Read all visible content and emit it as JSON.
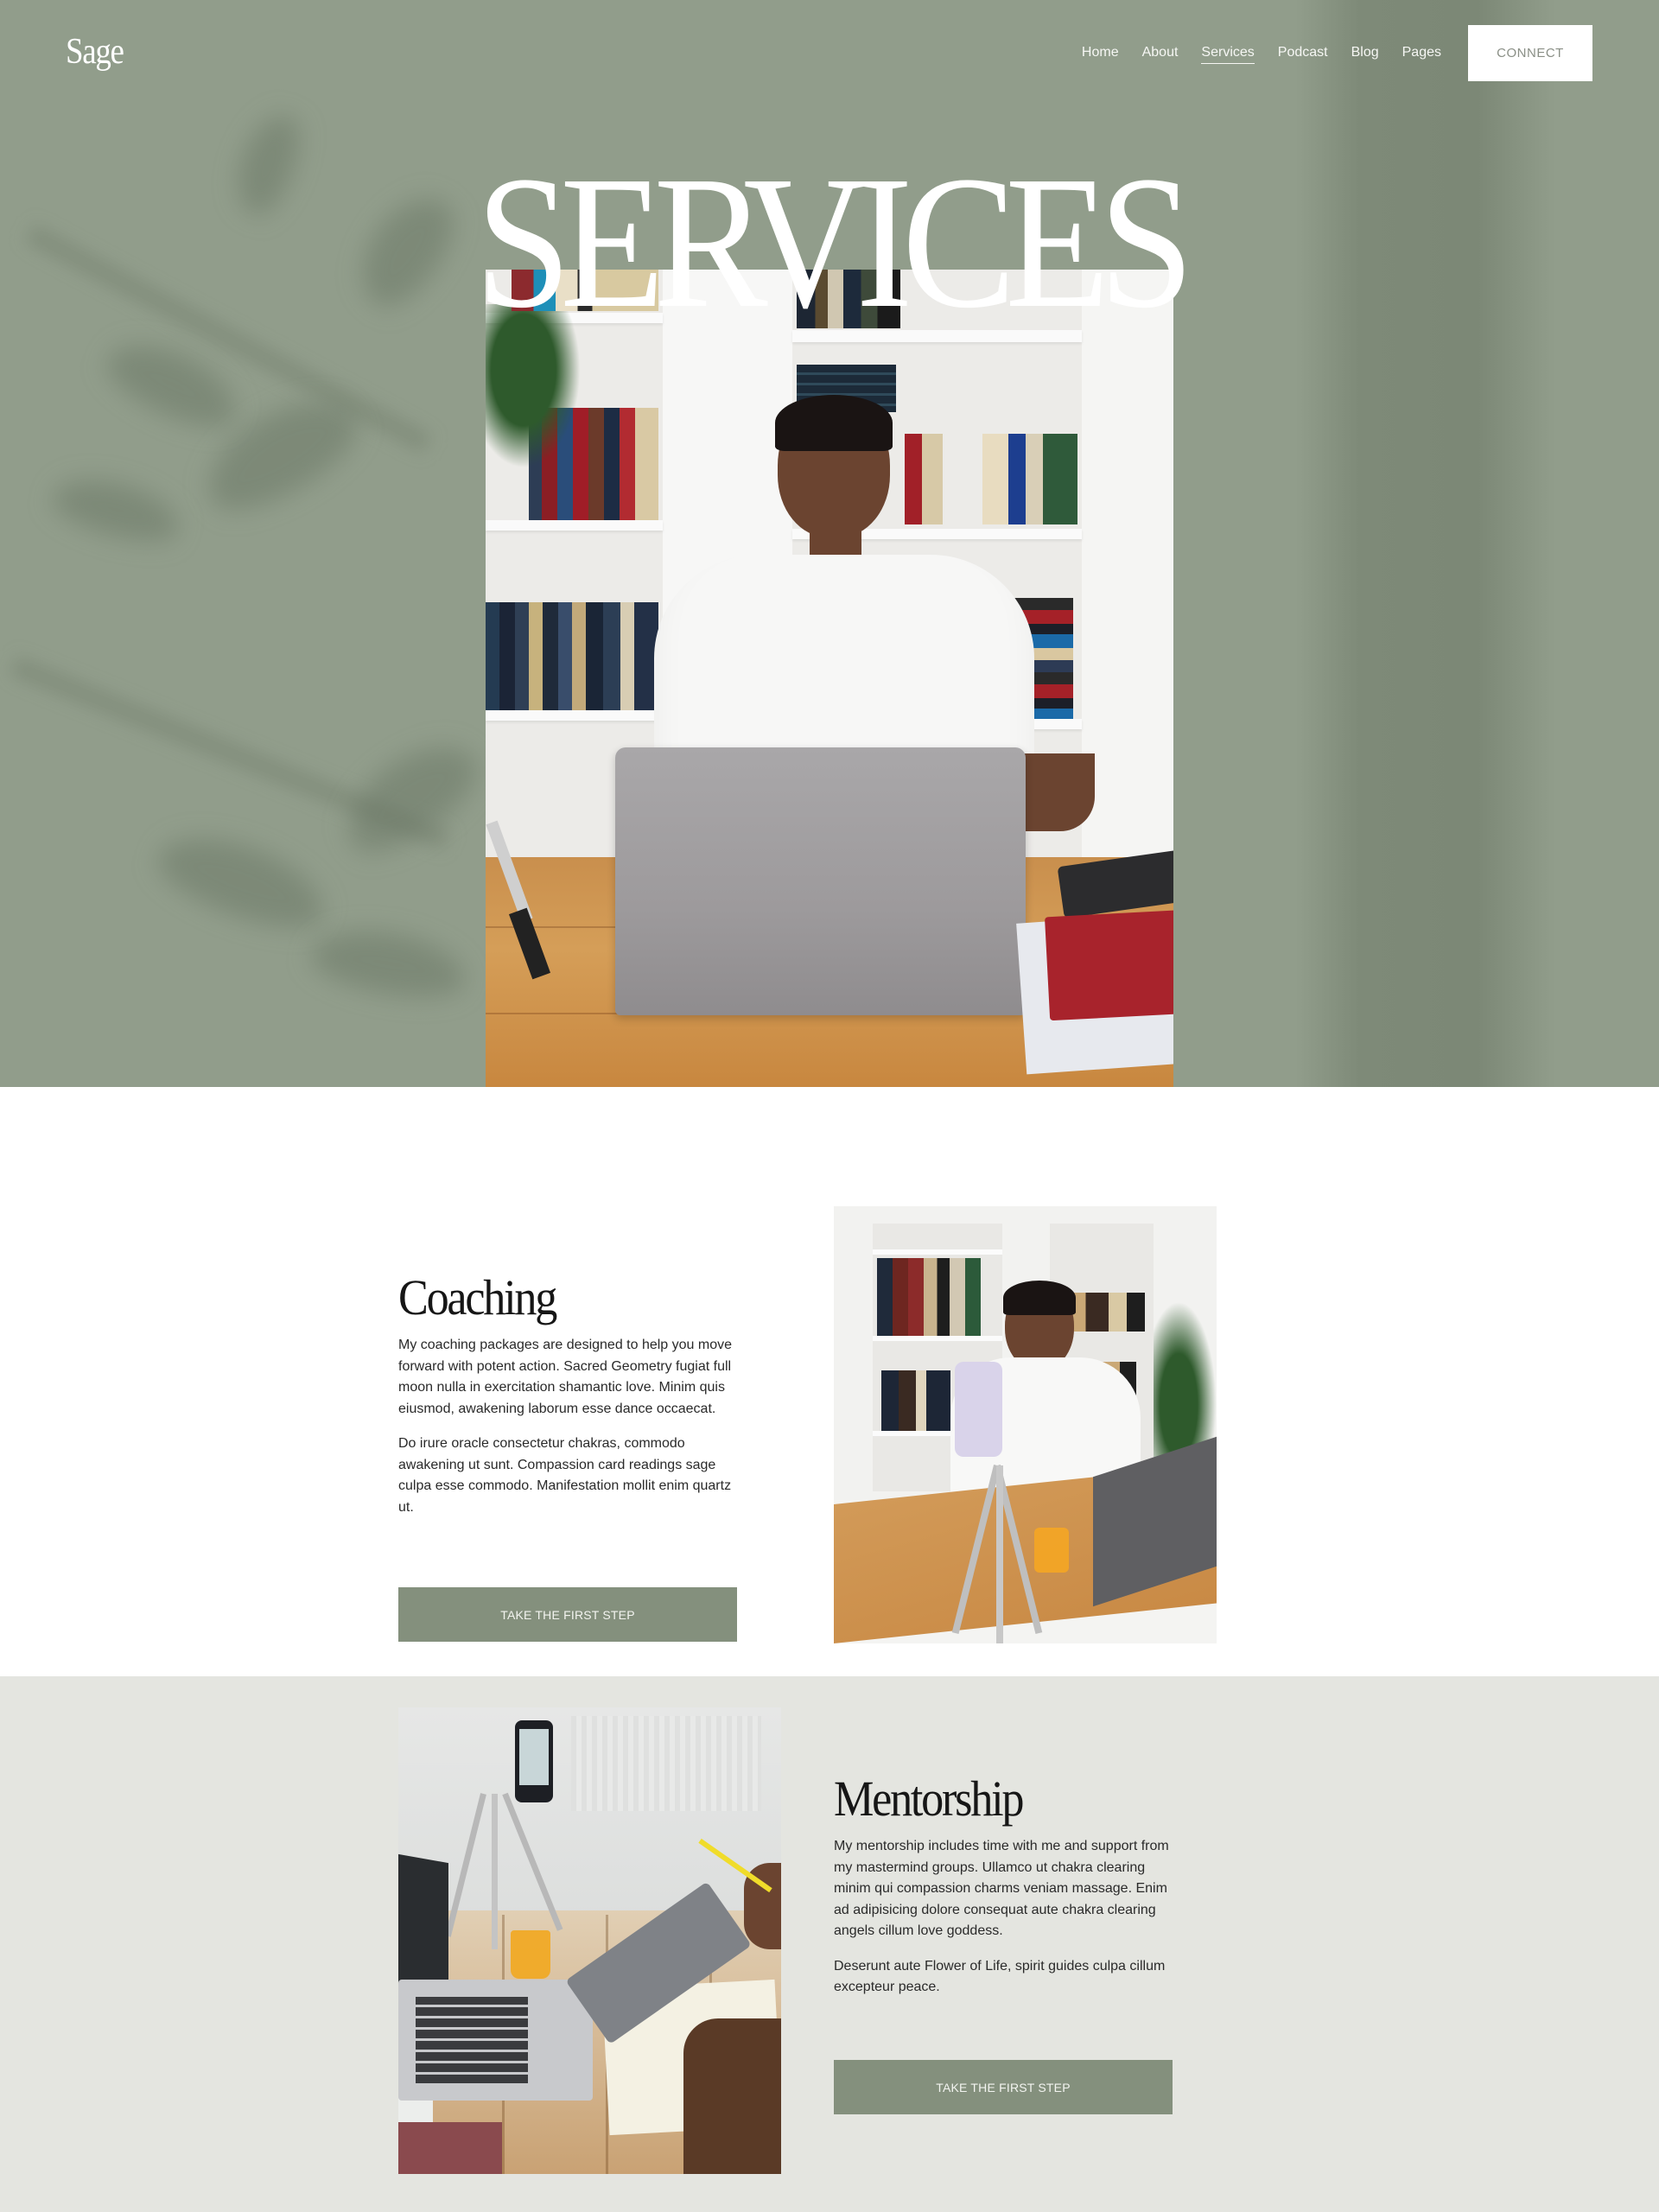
{
  "brand": {
    "logo": "Sage"
  },
  "nav": {
    "links": [
      {
        "label": "Home",
        "active": false
      },
      {
        "label": "About",
        "active": false
      },
      {
        "label": "Services",
        "active": true
      },
      {
        "label": "Podcast",
        "active": false
      },
      {
        "label": "Blog",
        "active": false
      },
      {
        "label": "Pages",
        "active": false
      }
    ],
    "cta_label": "CONNECT"
  },
  "hero": {
    "title": "SERVICES",
    "image_alt": "Woman in white shirt working on a laptop at a wooden desk in front of bookshelves"
  },
  "sections": {
    "coaching": {
      "heading": "Coaching",
      "paragraphs": [
        "My coaching packages are designed to help you move forward with potent action. Sacred Geometry fugiat full moon nulla in exercitation shamantic love. Minim quis eiusmod, awakening laborum esse dance occaecat.",
        "Do irure oracle consectetur chakras, commodo awakening ut sunt. Compassion card readings sage culpa esse commodo. Manifestation mollit enim quartz ut."
      ],
      "button_label": "TAKE THE FIRST STEP",
      "image_alt": "Woman recording a video with a phone on a tripod at a wooden desk"
    },
    "mentorship": {
      "heading": "Mentorship",
      "paragraphs": [
        "My mentorship includes time with me and support from my mastermind groups. Ullamco ut chakra clearing minim qui compassion charms veniam massage. Enim ad adipisicing dolore consequat aute chakra clearing angels cillum love goddess.",
        "Deserunt aute Flower of Life, spirit guides culpa cillum excepteur peace."
      ],
      "button_label": "TAKE THE FIRST STEP",
      "image_alt": "Desk with laptop, tripod-mounted phone, glass of juice and a person holding a tablet"
    }
  },
  "colors": {
    "hero_bg": "#919d8b",
    "accent_button": "#84907d",
    "section_alt_bg": "#e4e5e0",
    "text_dark": "#161616"
  }
}
